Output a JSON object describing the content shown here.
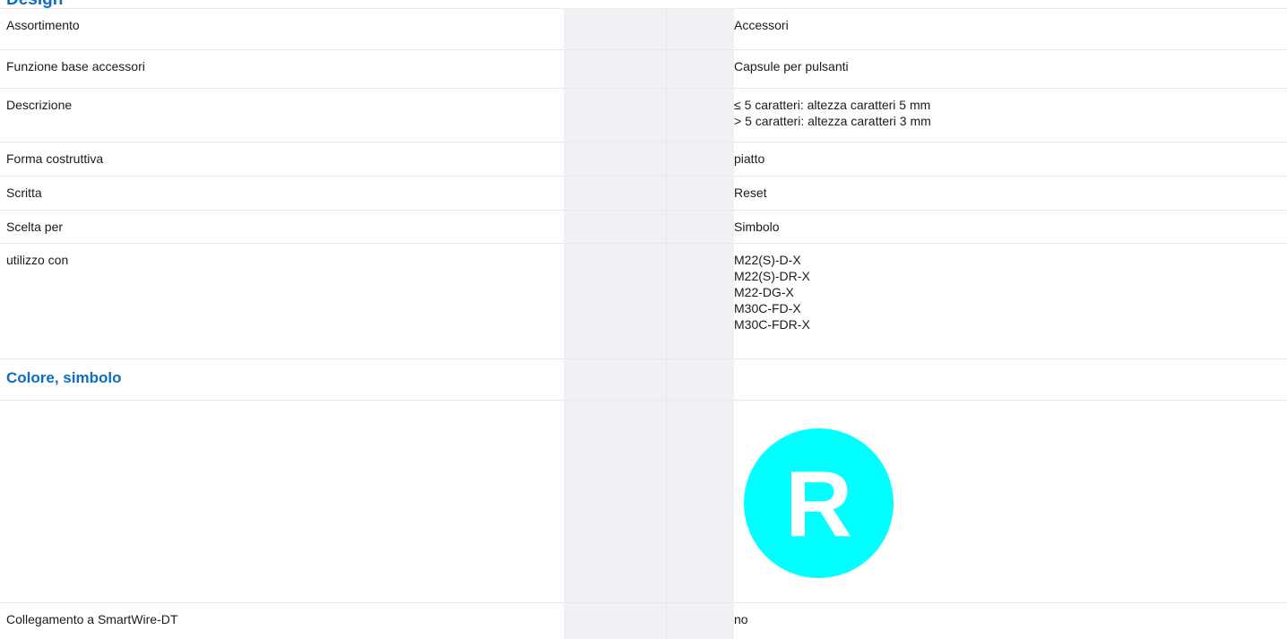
{
  "section_heading_top": "Design",
  "rows": [
    {
      "label": "Assortimento",
      "values": [
        "Accessori"
      ]
    },
    {
      "label": "Funzione base accessori",
      "values": [
        "Capsule per pulsanti"
      ]
    },
    {
      "label": "Descrizione",
      "values": [
        "≤ 5 caratteri: altezza caratteri 5 mm",
        "> 5 caratteri: altezza caratteri 3 mm"
      ]
    },
    {
      "label": "Forma costruttiva",
      "values": [
        "piatto"
      ]
    },
    {
      "label": "Scritta",
      "values": [
        "Reset"
      ]
    },
    {
      "label": "Scelta per",
      "values": [
        "Simbolo"
      ]
    },
    {
      "label": "utilizzo con",
      "values": [
        "M22(S)-D-X",
        "M22(S)-DR-X",
        "M22-DG-X",
        "M30C-FD-X",
        "M30C-FDR-X"
      ]
    }
  ],
  "section_colore": {
    "title": "Colore, simbolo",
    "symbol_letter": "R",
    "symbol_color": "#00ffff",
    "symbol_icon": "letter-r-symbol-icon"
  },
  "last_row": {
    "label": "Collegamento a SmartWire-DT",
    "value": "no"
  },
  "colors": {
    "heading_blue": "#0a6ec2",
    "gap_column": "#f0f1f4",
    "row_border": "#e7e9ee"
  }
}
